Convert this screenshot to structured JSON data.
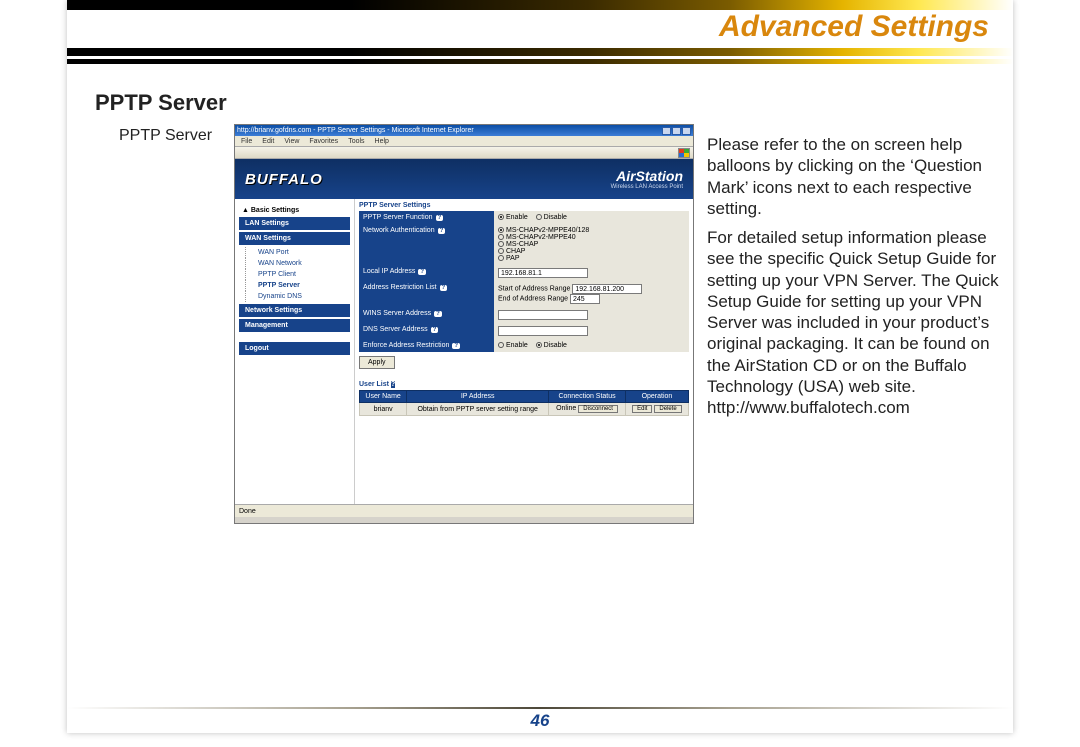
{
  "chapter_title": "Advanced Settings",
  "section_heading": "PPTP Server",
  "caption": "PPTP Server",
  "body": {
    "p1": "Please refer to the on screen help balloons by clicking on the ‘Question Mark’ icons next to each respective setting.",
    "p2": "For detailed setup information please see the specific Quick Setup Guide for setting up your VPN Server.  The Quick Setup Guide for setting up your VPN Server was included in your product’s original packaging.  It can be found on the AirStation CD or on the Buffalo Technology (USA) web site.  http://www.buffalotech.com"
  },
  "page_number": "46",
  "shot": {
    "title": "http://brianv.gofdns.com - PPTP Server Settings - Microsoft Internet Explorer",
    "menus": [
      "File",
      "Edit",
      "View",
      "Favorites",
      "Tools",
      "Help"
    ],
    "brand_left": "BUFFALO",
    "brand_right_big": "AirStation",
    "brand_right_small": "Wireless LAN Access Point",
    "side_head": "▲ Basic Settings",
    "nav": {
      "lan": "LAN Settings",
      "wan": "WAN Settings",
      "subs": [
        "WAN Port",
        "WAN Network",
        "PPTP Client",
        "PPTP Server",
        "Dynamic DNS"
      ],
      "network": "Network Settings",
      "management": "Management",
      "logout": "Logout"
    },
    "section_title": "PPTP Server Settings",
    "rows": {
      "func": {
        "label": "PPTP Server Function",
        "enable": "Enable",
        "disable": "Disable"
      },
      "auth": {
        "label": "Network Authentication",
        "o1": "MS-CHAPv2-MPPE40/128",
        "o2": "MS-CHAPv2-MPPE40",
        "o3": "MS-CHAP",
        "o4": "CHAP",
        "o5": "PAP"
      },
      "localip": {
        "label": "Local IP Address",
        "value": "192.168.81.1"
      },
      "restrict": {
        "label": "Address Restriction List",
        "start_lbl": "Start of Address Range",
        "start_val": "192.168.81.200",
        "end_lbl": "End of Address Range",
        "end_val": "245"
      },
      "wins": {
        "label": "WINS Server Address",
        "value": ""
      },
      "dns": {
        "label": "DNS Server Address",
        "value": ""
      },
      "enforce": {
        "label": "Enforce Address Restriction",
        "enable": "Enable",
        "disable": "Disable"
      }
    },
    "apply": "Apply",
    "userlist": {
      "title": "User List",
      "headers": [
        "User Name",
        "IP Address",
        "Connection Status",
        "Operation"
      ],
      "row": {
        "name": "brianv",
        "ip": "Obtain from PPTP server setting range",
        "status": "Online",
        "disconnect": "Disconnect",
        "edit": "Edit",
        "del": "Delete"
      }
    },
    "status_done": "Done"
  }
}
